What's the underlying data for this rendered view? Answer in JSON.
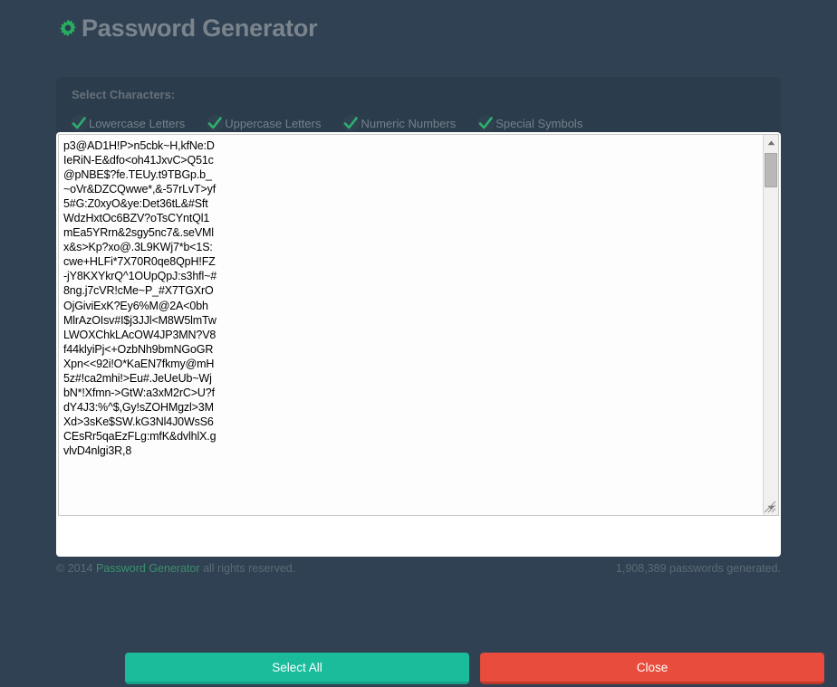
{
  "header": {
    "title": "Password Generator",
    "gear_icon": "gear-icon",
    "title_color": "#7b848c",
    "gear_color": "#27ae60"
  },
  "options": {
    "section_label": "Select Characters:",
    "checkboxes": [
      {
        "label": "Lowercase Letters",
        "checked": true
      },
      {
        "label": "Uppercase Letters",
        "checked": true
      },
      {
        "label": "Numeric Numbers",
        "checked": true
      },
      {
        "label": "Special Symbols",
        "checked": true
      }
    ],
    "check_color": "#2eaf6e"
  },
  "result": {
    "passwords_text": "p3@AD1H!P>n5cbk~H,kfNe:DIeRiN-E&dfo<oh41JxvC>Q51c@pNBE$?fe.TEUy.t9TBGp.b_~oVr&DZCQwwe*,&-57rLvT>yf5#G:Z0xyO&ye:Det36tL&#SftWdzHxtOc6BZV?oTsCYntQl1mEa5YRrn&2sgy5nc7&.seVMlx&s>Kp?xo@.3L9KWj7*b<1S:cwe+HLFi*7X70R0qe8QpH!FZ-jY8KXYkrQ^1OUpQpJ:s3hfl~#8ng.j7cVR!cMe~P_#X7TGXrOOjGiviExK?Ey6%M@2A<0bhMlrAzOIsv#I$j3JJl<M8W5lmTwLWOXChkLAcOW4JP3MN?V8f44klyiPj<+OzbNh9bmNGoGRXpn<<92i!O*KaEN7fkmy@mH5z#!ca2mhi!>Eu#.JeUeUb~WjbN*!Xfmn->GtW:a3xM2rC>U?fdY4J3:%^$,Gy!sZOHMgzl>3MXd>3sKe$SW.kG3Nl4J0WsS6CEsRr5qaEzFLg:mfK&dvlhlX.gvlvD4nlgi3R,8",
    "scrollbar": {
      "up_arrow_icon": "caret-up-icon",
      "down_arrow_icon": "caret-down-icon",
      "thumb": "scrollbar-thumb"
    },
    "resize_grip_icon": "resize-grip-icon"
  },
  "actions": {
    "select_all_label": "Select All",
    "select_all_color": "#1abc9c",
    "close_label": "Close",
    "close_color": "#e74c3c"
  },
  "footer": {
    "copyright_prefix": "© 2014 ",
    "brand": "Password Generator",
    "copyright_suffix": " all rights reserved.",
    "counter": "1,908,389 passwords generated."
  }
}
